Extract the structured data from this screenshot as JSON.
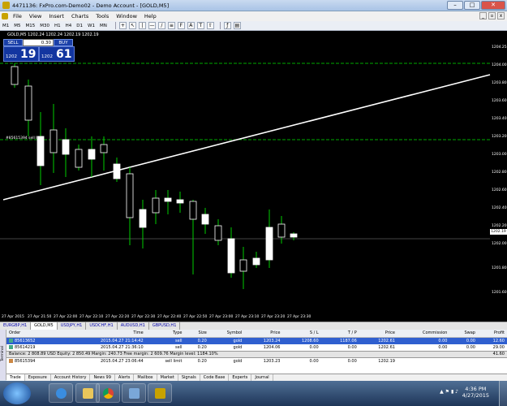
{
  "window": {
    "title": "4471136: FxPro.com-Demo02 - Demo Account - [GOLD,M5]",
    "min": "–",
    "max": "□",
    "close": "✕"
  },
  "menu": [
    "File",
    "View",
    "Insert",
    "Charts",
    "Tools",
    "Window",
    "Help"
  ],
  "timeframes": [
    "M1",
    "M5",
    "M15",
    "M30",
    "H1",
    "H4",
    "D1",
    "W1",
    "MN"
  ],
  "chart": {
    "symbol_line": "GOLD,M5  1202.24 1202.24 1202.19 1202.19",
    "order_label": "#85615394 sell limit",
    "current_price": "1202.19",
    "price_ticks": [
      "1204.25",
      "1204.00",
      "1203.80",
      "1203.60",
      "1203.40",
      "1203.20",
      "1203.00",
      "1202.80",
      "1202.60",
      "1202.40",
      "1202.20",
      "1202.00",
      "1201.80",
      "1201.60"
    ],
    "time_ticks": [
      "27 Apr 2015",
      "27 Apr 21:50",
      "27 Apr 22:00",
      "27 Apr 22:10",
      "27 Apr 22:20",
      "27 Apr 22:30",
      "27 Apr 22:40",
      "27 Apr 22:50",
      "27 Apr 23:00",
      "27 Apr 23:10",
      "27 Apr 23:20",
      "27 Apr 23:30"
    ]
  },
  "trade_panel": {
    "sell_label": "SELL",
    "buy_label": "BUY",
    "lots": "0.30",
    "sell_small": "1202",
    "sell_big": "19",
    "buy_small": "1202",
    "buy_big": "61"
  },
  "chart_tabs": [
    "EURGBP,H1",
    "GOLD,M5",
    "USDJPY,H1",
    "USDCHF,H1",
    "AUDUSD,H1",
    "GBPUSD,H1"
  ],
  "terminal": {
    "side_label": "Terminal",
    "headers": [
      "Order",
      "Time",
      "Type",
      "Size",
      "Symbol",
      "Price",
      "S / L",
      "T / P",
      "Price",
      "Commission",
      "Swap",
      "Profit"
    ],
    "rows": [
      [
        "85613652",
        "2015.04.27 21:14:42",
        "sell",
        "0.20",
        "gold",
        "1203.24",
        "1208.60",
        "1187.06",
        "1202.61",
        "0.00",
        "0.00",
        "12.60"
      ],
      [
        "85614219",
        "2015.04.27 21:36:10",
        "sell",
        "0.20",
        "gold",
        "1204.06",
        "0.00",
        "0.00",
        "1202.61",
        "0.00",
        "0.00",
        "29.00"
      ]
    ],
    "balance_text": "Balance: 2 808.89 USD  Equity: 2 850.49  Margin: 240.73  Free margin: 2 609.76  Margin level: 1184.10%",
    "balance_profit": "41.60",
    "pending": [
      "85615394",
      "2015.04.27 23:06:44",
      "sell limit",
      "0.20",
      "gold",
      "1203.23",
      "0.00",
      "0.00",
      "1202.19",
      "",
      ""
    ],
    "tabs": [
      "Trade",
      "Exposure",
      "Account History",
      "News 99",
      "Alerts",
      "Mailbox",
      "Market",
      "Signals",
      "Code Base",
      "Experts",
      "Journal"
    ]
  },
  "taskbar": {
    "time": "4:36 PM",
    "date": "4/27/2015"
  },
  "colors": {
    "chart_bg": "#000000",
    "accent": "#2f5fcf",
    "trend_line": "#ffffff",
    "grid_dash": "#00aa00"
  }
}
